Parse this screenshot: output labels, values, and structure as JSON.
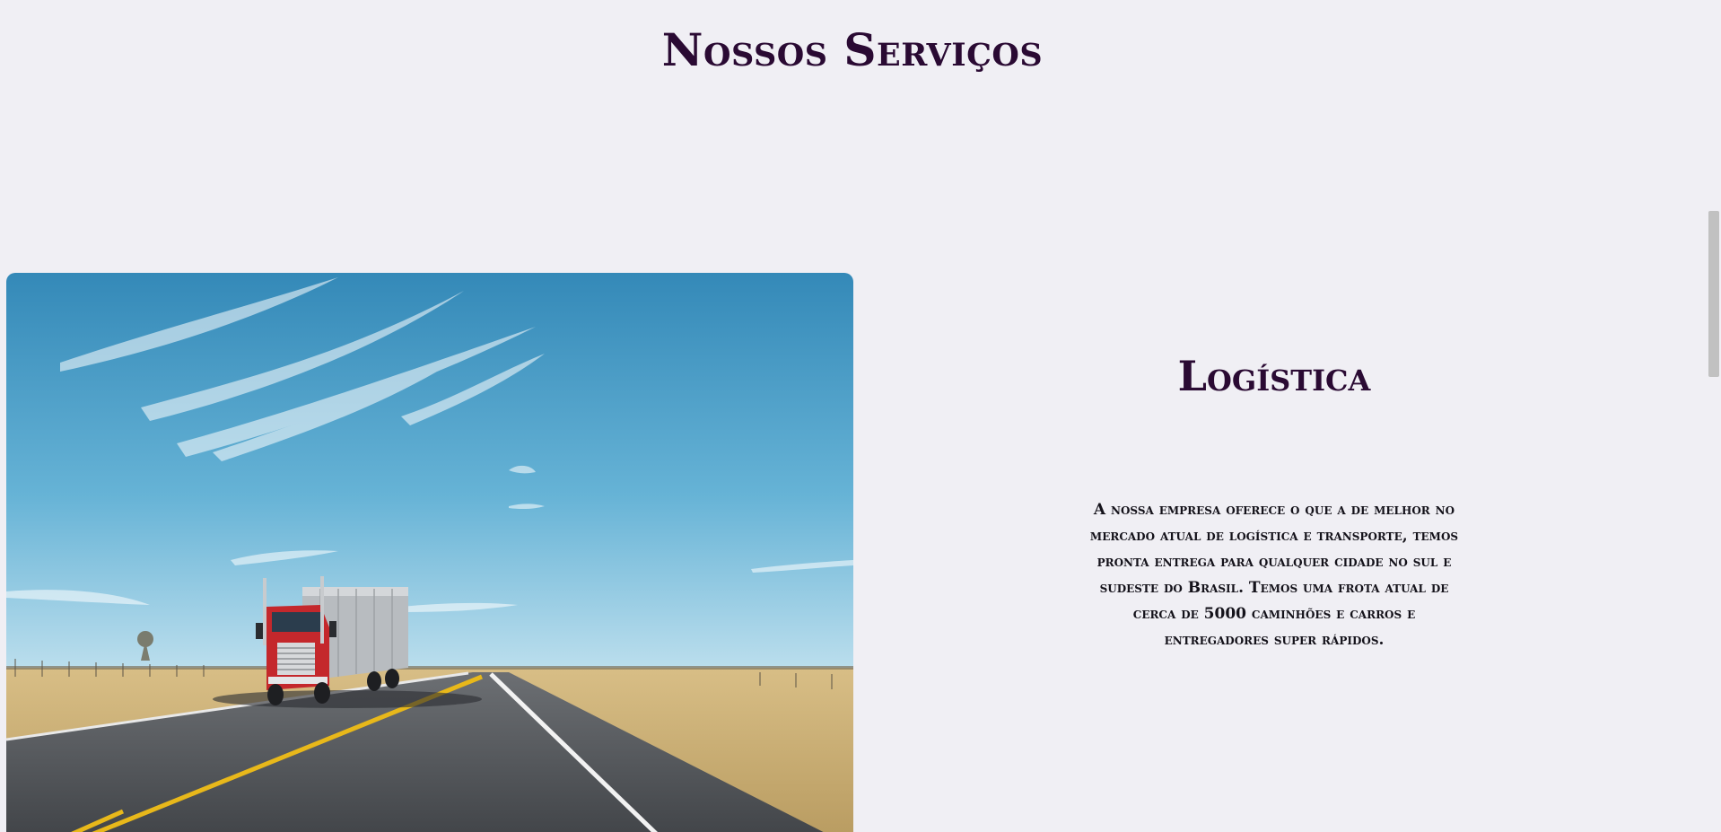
{
  "section": {
    "title": "Nossos Serviços"
  },
  "service": {
    "title": "Logística",
    "description": "A nossa empresa oferece o que a de melhor no mercado atual de logística e transporte, temos pronta entrega para qualquer cidade no sul e sudeste do Brasil. Temos uma frota atual de cerca de 5000 caminhões e carros e entregadores super rápidos.",
    "image_subject": "truck-on-highway"
  },
  "colors": {
    "background": "#f0eff4",
    "heading": "#2a0a33",
    "text": "#14121a",
    "sky": "#3f96c4",
    "truck_cab": "#c4282c",
    "road": "#4a4d52",
    "road_line_yellow": "#e8b81a",
    "grass": "#c9a86a"
  }
}
